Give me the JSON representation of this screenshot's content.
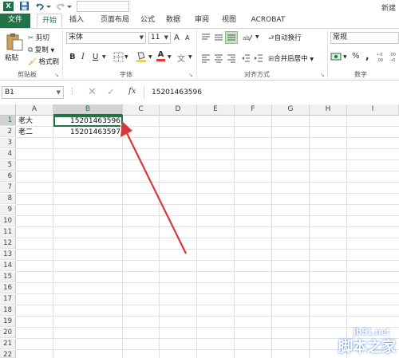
{
  "titlebar": {
    "logo": "X",
    "doc_title": "新建"
  },
  "tabs": [
    {
      "label": "文件"
    },
    {
      "label": "开始"
    },
    {
      "label": "插入"
    },
    {
      "label": "页面布局"
    },
    {
      "label": "公式"
    },
    {
      "label": "数据"
    },
    {
      "label": "审阅"
    },
    {
      "label": "视图"
    },
    {
      "label": "ACROBAT"
    }
  ],
  "ribbon": {
    "clipboard": {
      "paste": "粘贴",
      "cut": "剪切",
      "copy": "复制",
      "format_painter": "格式刷",
      "group": "剪贴板"
    },
    "font": {
      "name": "宋体",
      "size": "11",
      "grow": "A",
      "shrink": "A",
      "bold": "B",
      "italic": "I",
      "underline": "U",
      "font_color": "A",
      "group": "字体"
    },
    "alignment": {
      "wrap": "自动换行",
      "merge": "合并后居中",
      "group": "对齐方式"
    },
    "number": {
      "format": "常规",
      "percent": "%",
      "comma": ",",
      "group": "数字"
    },
    "colors": {
      "accent": "#217346",
      "font_color_bar": "#e03a2f",
      "fill_color_bar": "#ffd800"
    }
  },
  "formula_bar": {
    "name_box": "B1",
    "value": "15201463596",
    "fx": "fx"
  },
  "columns": [
    "A",
    "B",
    "C",
    "D",
    "E",
    "F",
    "G",
    "H",
    "I"
  ],
  "rows": [
    "1",
    "2",
    "3",
    "4",
    "5",
    "6",
    "7",
    "8",
    "9",
    "10",
    "11",
    "12",
    "13",
    "14",
    "15",
    "16",
    "17",
    "18",
    "19",
    "20",
    "21",
    "22"
  ],
  "cells": {
    "A1": "老大",
    "A2": "老二",
    "B1": "15201463596",
    "B2": "15201463597"
  },
  "watermark": {
    "site": "jb51.net",
    "name": "脚本之家"
  },
  "annotation": {
    "color": "#d9373b"
  }
}
